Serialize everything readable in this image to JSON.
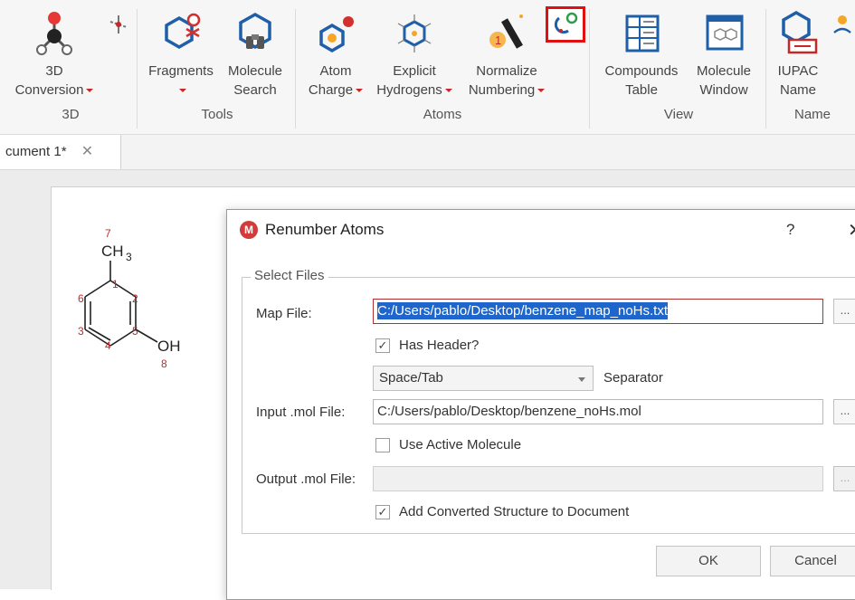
{
  "ribbon": {
    "buttons": {
      "conversion": "3D\nConversion",
      "fragments": "Fragments",
      "molecule_search": "Molecule\nSearch",
      "atom_charge": "Atom\nCharge",
      "explicit_hydrogens": "Explicit\nHydrogens",
      "normalize_numbering": "Normalize\nNumbering",
      "compounds_table": "Compounds\nTable",
      "molecule_window": "Molecule\nWindow",
      "iupac_name": "IUPAC\nName"
    },
    "groups": {
      "g3d": "3D",
      "tools": "Tools",
      "atoms": "Atoms",
      "view": "View",
      "name": "Name"
    },
    "colors": {
      "accent": "#c62828",
      "highlight": "#e01010"
    }
  },
  "tabs": [
    {
      "label": "cument 1*",
      "close": "✕"
    }
  ],
  "molecule": {
    "methyl_label": "CH",
    "methyl_sub": "3",
    "oh_label": "OH",
    "atom_numbers": [
      "1",
      "2",
      "3",
      "4",
      "5",
      "6",
      "7",
      "8"
    ]
  },
  "dialog": {
    "title": "Renumber Atoms",
    "help": "?",
    "close": "✕",
    "group_title": "Select Files",
    "map_file_label": "Map File:",
    "map_file_value": "C:/Users/pablo/Desktop/benzene_map_noHs.txt",
    "has_header_label": "Has Header?",
    "separator_value": "Space/Tab",
    "separator_label": "Separator",
    "input_label": "Input .mol File:",
    "input_value": "C:/Users/pablo/Desktop/benzene_noHs.mol",
    "use_active_label": "Use Active Molecule",
    "output_label": "Output .mol File:",
    "output_value": "",
    "add_converted_label": "Add Converted Structure to Document",
    "browse": "...",
    "ok": "OK",
    "cancel": "Cancel",
    "checkboxes": {
      "has_header": true,
      "use_active": false,
      "add_converted": true
    }
  }
}
